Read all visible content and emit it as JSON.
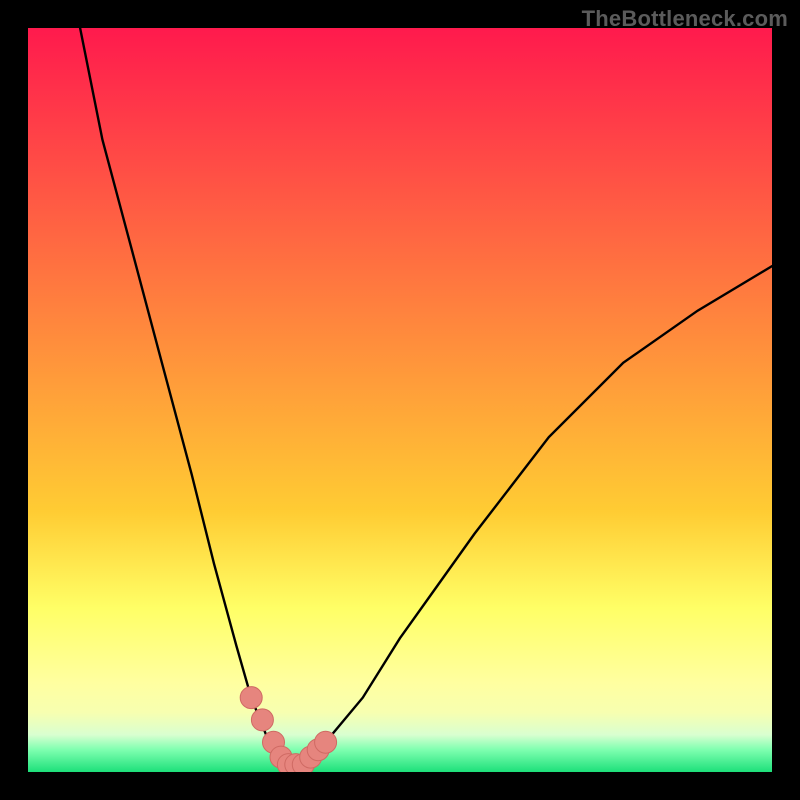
{
  "watermark": "TheBottleneck.com",
  "colors": {
    "frame": "#000000",
    "watermark": "#5b5b5b",
    "curve": "#000000",
    "marker_fill": "#e6857e",
    "marker_stroke": "#cf6a63",
    "grad_top": "#ff1a4d",
    "grad_mid1": "#ff6a2a",
    "grad_mid2": "#ffcc33",
    "grad_mid3": "#ffff66",
    "grad_mid4": "#f7ffb0",
    "grad_mid5": "#d9ffd0",
    "grad_bottom": "#1de07a"
  },
  "chart_data": {
    "type": "line",
    "title": "",
    "xlabel": "",
    "ylabel": "",
    "xlim": [
      0,
      100
    ],
    "ylim": [
      0,
      100
    ],
    "grid": false,
    "series": [
      {
        "name": "bottleneck-curve",
        "x": [
          7,
          10,
          14,
          18,
          22,
          25,
          28,
          30,
          32,
          34,
          35,
          36,
          37,
          38,
          40,
          45,
          50,
          55,
          60,
          70,
          80,
          90,
          100
        ],
        "y": [
          100,
          85,
          70,
          55,
          40,
          28,
          17,
          10,
          5,
          2,
          1,
          1,
          1,
          2,
          4,
          10,
          18,
          25,
          32,
          45,
          55,
          62,
          68
        ]
      }
    ],
    "markers": {
      "name": "highlight-points",
      "x": [
        30,
        31.5,
        33,
        34,
        35,
        36,
        37,
        38,
        39,
        40
      ],
      "y": [
        10,
        7,
        4,
        2,
        1,
        1,
        1,
        2,
        3,
        4
      ]
    },
    "gradient_bands_y": [
      0,
      65,
      78,
      88,
      92,
      95,
      97,
      100
    ]
  }
}
